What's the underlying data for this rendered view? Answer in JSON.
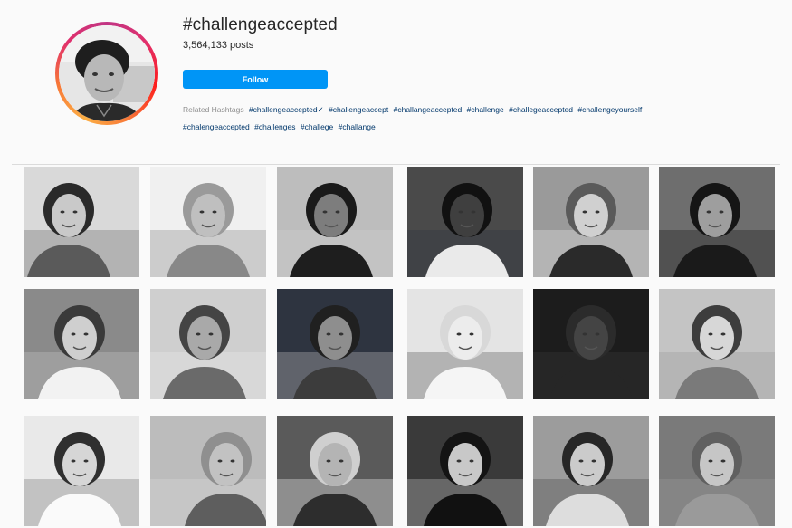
{
  "header": {
    "title": "#challengeaccepted",
    "posts": "3,564,133 posts",
    "follow_label": "Follow",
    "ring_colors": [
      "#c13584",
      "#e1306c",
      "#fd1d1d",
      "#f77737",
      "#fcaf45"
    ],
    "button_color": "#0095f6"
  },
  "related": {
    "label": "Related Hashtags",
    "tags": [
      "#challengeaccepted✓",
      "#challengeaccept",
      "#challangeaccepted",
      "#challenge",
      "#challegeaccepted",
      "#challengeyourself",
      "#chalengeaccepted",
      "#challenges",
      "#challege",
      "#challange"
    ]
  },
  "grid": {
    "tiles": [
      {
        "name": "post-two-women-selfie"
      },
      {
        "name": "post-woman-hat-city-view"
      },
      {
        "name": "post-curly-hair-smiling-woman"
      },
      {
        "name": "post-braids-woman-selfie"
      },
      {
        "name": "post-long-hair-woman-closeup"
      },
      {
        "name": "post-woman-by-harbor"
      },
      {
        "name": "post-woman-sunglasses-headband"
      },
      {
        "name": "post-woman-cap-mirrored-sunglasses"
      },
      {
        "name": "post-woman-night-city"
      },
      {
        "name": "post-blonde-woman-smiling"
      },
      {
        "name": "post-woman-standing-night-lake"
      },
      {
        "name": "post-woman-dark-hair-portrait"
      },
      {
        "name": "post-woman-white-dress-field"
      },
      {
        "name": "post-woman-lying-selfie"
      },
      {
        "name": "post-woman-glasses-disneyland"
      },
      {
        "name": "post-woman-long-dark-hair"
      },
      {
        "name": "post-woman-short-hair-patterned-shirt"
      },
      {
        "name": "post-group-older-women"
      }
    ]
  }
}
